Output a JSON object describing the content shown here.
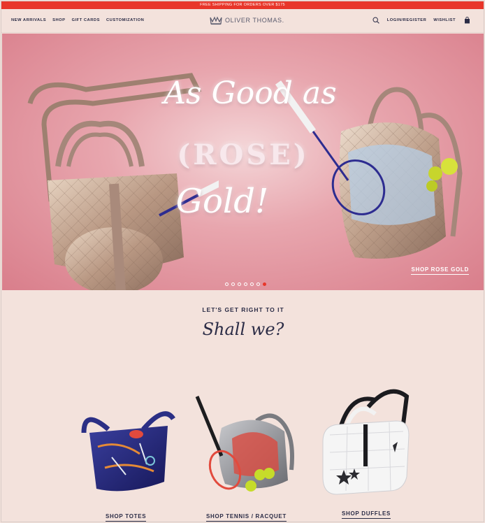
{
  "promo_bar": {
    "text": "FREE SHIPPING FOR ORDERS OVER $175"
  },
  "nav": {
    "left_items": [
      "NEW ARRIVALS",
      "SHOP",
      "GIFT CARDS",
      "CUSTOMIZATION"
    ],
    "logo": "OLIVER THOMAS.",
    "login": "LOGIN/REGISTER",
    "wishlist": "WISHLIST"
  },
  "hero": {
    "line1": "As Good as",
    "line2": "(ROSE)",
    "line3": "Gold!",
    "cta": "SHOP ROSE GOLD",
    "slide_count": 7,
    "active_slide": 7
  },
  "intro": {
    "kicker": "LET'S GET RIGHT TO IT",
    "headline": "Shall we?"
  },
  "categories": [
    {
      "label": "SHOP TOTES"
    },
    {
      "label": "SHOP TENNIS / RACQUET"
    },
    {
      "label": "SHOP DUFFLES"
    }
  ],
  "colors": {
    "accent": "#e8362a",
    "navy": "#2b2c46",
    "background": "#f3e2dc",
    "hero_pink": "#e8a6ae"
  }
}
